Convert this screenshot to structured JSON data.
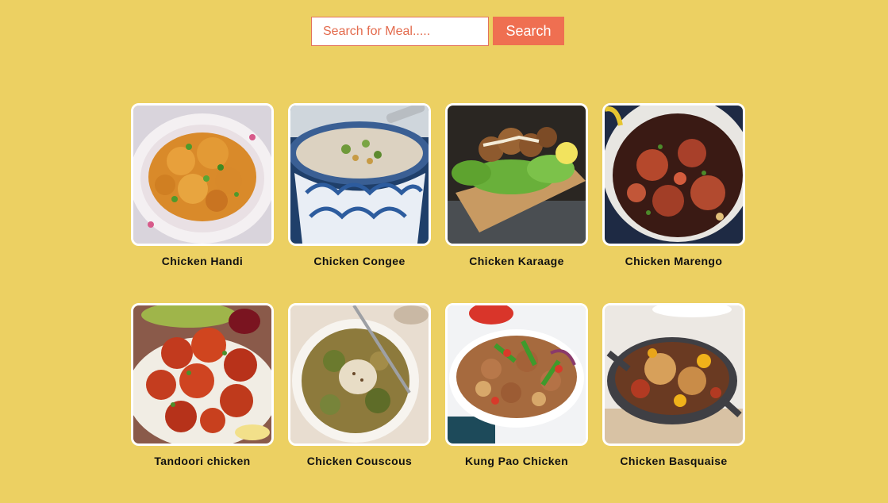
{
  "search": {
    "placeholder": "Search for Meal.....",
    "value": "",
    "button_label": "Search"
  },
  "colors": {
    "background": "#ecd062",
    "accent": "#ef6f51",
    "card_border": "#ffffff"
  },
  "meals": [
    {
      "name": "Chicken Handi",
      "image": "chicken-handi-image"
    },
    {
      "name": "Chicken Congee",
      "image": "chicken-congee-image"
    },
    {
      "name": "Chicken Karaage",
      "image": "chicken-karaage-image"
    },
    {
      "name": "Chicken Marengo",
      "image": "chicken-marengo-image"
    },
    {
      "name": "Tandoori chicken",
      "image": "tandoori-chicken-image"
    },
    {
      "name": "Chicken Couscous",
      "image": "chicken-couscous-image"
    },
    {
      "name": "Kung Pao Chicken",
      "image": "kung-pao-chicken-image"
    },
    {
      "name": "Chicken Basquaise",
      "image": "chicken-basquaise-image"
    }
  ]
}
